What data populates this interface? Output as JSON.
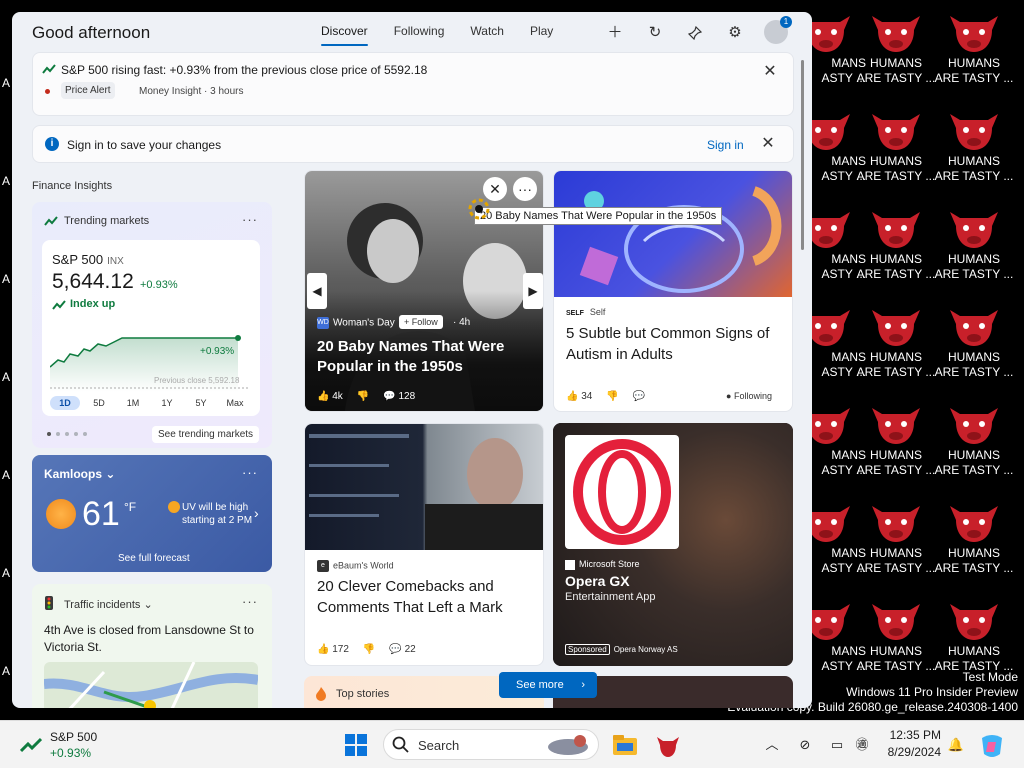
{
  "desktop": {
    "tile_line1": "HUMANS",
    "tile_line2": "ARE TASTY ...",
    "partial_line1": "MANS",
    "partial_line2": "ASTY ...",
    "left_edge_char": "A"
  },
  "watermark": {
    "line1": "Test Mode",
    "line2": "Windows 11 Pro Insider Preview",
    "line3": "Evaluation copy. Build 26080.ge_release.240308-1400"
  },
  "header": {
    "greeting": "Good afternoon",
    "tabs": [
      {
        "label": "Discover",
        "active": true
      },
      {
        "label": "Following",
        "active": false
      },
      {
        "label": "Watch",
        "active": false
      },
      {
        "label": "Play",
        "active": false
      }
    ],
    "icons": [
      "add-icon",
      "refresh-icon",
      "pin-icon",
      "settings-icon"
    ],
    "notification_count": "1"
  },
  "price_alert": {
    "text": "S&P 500 rising fast: +0.93% from the previous close price of 5592.18",
    "tag": "Price Alert",
    "source": "Money Insight · 3 hours"
  },
  "signin_banner": {
    "text": "Sign in to save your changes",
    "link": "Sign in"
  },
  "finance": {
    "section_label": "Finance Insights",
    "card_title": "Trending markets",
    "index_name": "S&P 500",
    "ticker": "INX",
    "price": "5,644.12",
    "change": "+0.93%",
    "trend_label": "Index up",
    "chart_change_label": "+0.93%",
    "prev_close_label": "Previous close 5,592.18",
    "ranges": [
      {
        "label": "1D",
        "active": true
      },
      {
        "label": "5D",
        "active": false
      },
      {
        "label": "1M",
        "active": false
      },
      {
        "label": "1Y",
        "active": false
      },
      {
        "label": "5Y",
        "active": false
      },
      {
        "label": "Max",
        "active": false
      }
    ],
    "see_more": "See trending markets",
    "pager_count": 5,
    "pager_active": 0
  },
  "weather": {
    "city": "Kamloops",
    "temperature": "61",
    "unit": "°F",
    "uv_text": "UV will be high starting at 2 PM",
    "forecast_link": "See full forecast"
  },
  "traffic": {
    "title": "Traffic incidents",
    "message": "4th Ave is closed from Lansdowne St to Victoria St."
  },
  "news": [
    {
      "publisher": "Woman's Day",
      "follow_label": "Follow",
      "age": "4h",
      "headline": "20 Baby Names That Were Popular in the 1950s",
      "likes": "4k",
      "comments": "128",
      "tooltip": "20 Baby Names That Were Popular in the 1950s"
    },
    {
      "publisher": "Self",
      "publisher_badge": "SELF",
      "headline": "5 Subtle but Common Signs of Autism in Adults",
      "likes": "34",
      "status": "Following"
    },
    {
      "publisher": "eBaum's World",
      "headline": "20 Clever Comebacks and Comments That Left a Mark",
      "likes": "172",
      "comments": "22"
    },
    {
      "publisher": "Microsoft Store",
      "headline": "Opera GX",
      "subtitle": "Entertainment App",
      "sponsored_label": "Sponsored",
      "advertiser": "Opera Norway AS"
    }
  ],
  "top_stories": {
    "title": "Top stories"
  },
  "see_more_button": "See more",
  "taskbar": {
    "stock_name": "S&P 500",
    "stock_change": "+0.93%",
    "search_placeholder": "Search",
    "time": "12:35 PM",
    "date": "8/29/2024"
  },
  "colors": {
    "accent": "#0067c0",
    "positive": "#0f7b3f",
    "alert_dot": "#c42b1c"
  }
}
